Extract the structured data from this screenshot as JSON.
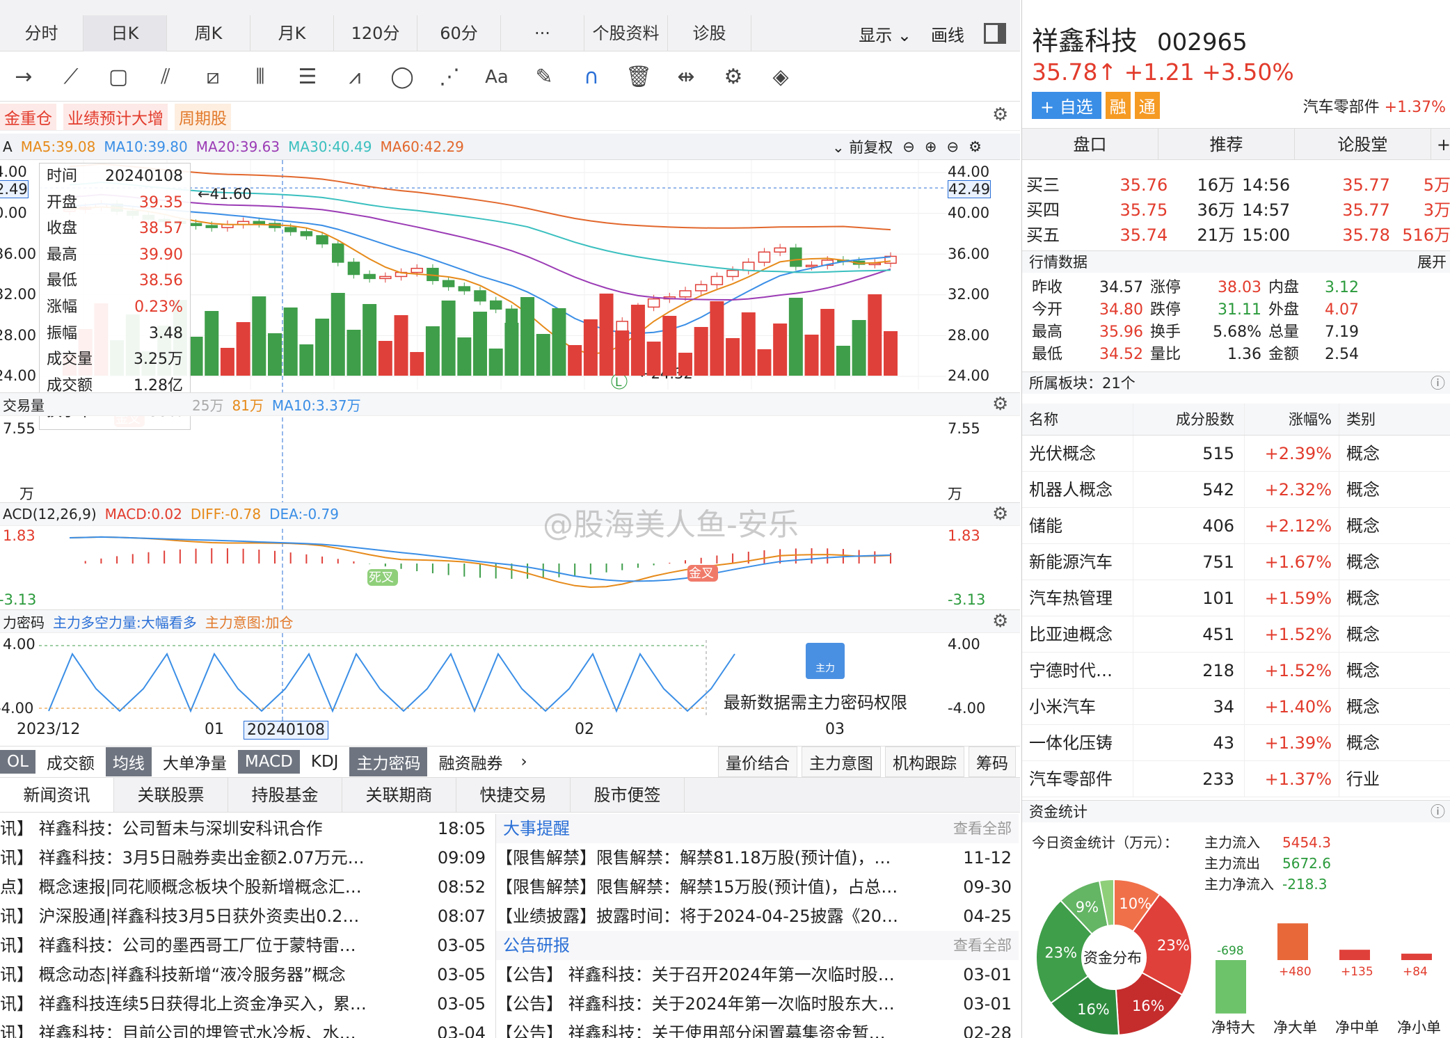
{
  "tabs": [
    "分时",
    "日K",
    "周K",
    "月K",
    "120分",
    "60分",
    "···",
    "个股资料",
    "诊股"
  ],
  "tabs_right": {
    "display": "显示",
    "draw": "画线"
  },
  "tags": [
    "金重仓",
    "业绩预计大增",
    "周期股"
  ],
  "ma": {
    "ma5": "MA5:39.08",
    "ma10": "MA10:39.80",
    "ma20": "MA20:39.63",
    "ma30": "MA30:40.49",
    "ma60": "MA60:42.29",
    "fq": "前复权",
    "ma5c": "#e68a1a",
    "ma10c": "#3a8ee6",
    "ma20c": "#9b3bb5",
    "ma30c": "#3abfbf",
    "ma60c": "#e2672c"
  },
  "y_left": [
    "4.00",
    "2.49",
    "0.00",
    "36.00",
    "32.00",
    "28.00",
    "24.00"
  ],
  "y_right": [
    "44.00",
    "42.49",
    "40.00",
    "36.00",
    "32.00",
    "28.00",
    "24.00"
  ],
  "price_labels": {
    "high": "41.60",
    "low": "←24.32",
    "low_mark": "L"
  },
  "info": [
    [
      "时间",
      "20240108"
    ],
    [
      "开盘",
      "39.35"
    ],
    [
      "收盘",
      "38.57"
    ],
    [
      "最高",
      "39.90"
    ],
    [
      "最低",
      "38.56"
    ],
    [
      "涨幅",
      "0.23%"
    ],
    [
      "振幅",
      "3.48"
    ],
    [
      "成交量",
      "3.25万"
    ],
    [
      "成交额",
      "1.28亿"
    ],
    [
      "换手率",
      "2.59%"
    ]
  ],
  "vol_head": {
    "label": "交易量",
    "v1": "25万",
    "v2": "81万",
    "ma10": "MA10:3.37万",
    "max": "7.55",
    "unit": "万"
  },
  "macd_head": {
    "label": "ACD(12,26,9)",
    "macd": "MACD:0.02",
    "diff": "DIFF:-0.78",
    "dea": "DEA:-0.79",
    "top": "1.83",
    "bottom": "-3.13",
    "gold": "金叉",
    "dead": "死叉"
  },
  "zl_head": {
    "label": "力密码",
    "l1": "主力多空力量:大幅看多",
    "l2": "主力意图:加仓",
    "top": "4.00",
    "bottom": "-4.00",
    "lock_text": "最新数据需主力密码权限",
    "lock_icon": "主力"
  },
  "xaxis": [
    "2023/12",
    "01",
    "20240108",
    "02",
    "03"
  ],
  "watermark": "@股海美人鱼-安乐",
  "indicators": [
    "OL",
    "成交额",
    "均线",
    "大单净量",
    "MACD",
    "KDJ",
    "主力密码",
    "融资融券"
  ],
  "ind_right": [
    "量价结合",
    "主力意图",
    "机构跟踪",
    "筹码"
  ],
  "news_tabs": [
    "新闻资讯",
    "关联股票",
    "持股基金",
    "关联期商",
    "快捷交易",
    "股市便签"
  ],
  "news": [
    [
      "讯】 祥鑫科技：公司暂未与深圳安科讯合作",
      "18:05"
    ],
    [
      "讯】 祥鑫科技：3月5日融券卖出金额2.07万元…",
      "09:09"
    ],
    [
      "点】 概念速报|同花顺概念板块个股新增概念汇…",
      "08:52"
    ],
    [
      "讯】 沪深股通|祥鑫科技3月5日获外资卖出0.2…",
      "08:07"
    ],
    [
      "讯】 祥鑫科技：公司的墨西哥工厂位于蒙特雷…",
      "03-05"
    ],
    [
      "讯】 概念动态|祥鑫科技新增“液冷服务器”概念",
      "03-05"
    ],
    [
      "讯】 祥鑫科技连续5日获得北上资金净买入，累…",
      "03-05"
    ],
    [
      "讯】 祥鑫科技：目前公司的埋管式水冷板、水…",
      "03-04"
    ]
  ],
  "events_head": {
    "title": "大事提醒",
    "more": "查看全部"
  },
  "events": [
    [
      "【限售解禁】限售解禁：解禁81.18万股(预计值)，…",
      "11-12"
    ],
    [
      "【限售解禁】限售解禁：解禁15万股(预计值)，占总…",
      "09-30"
    ],
    [
      "【业绩披露】披露时间：将于2024-04-25披露《20…",
      "04-25"
    ]
  ],
  "notice_head": {
    "title": "公告研报",
    "more": "查看全部"
  },
  "notices": [
    [
      "【公告】 祥鑫科技：关于召开2024年第一次临时股…",
      "03-01"
    ],
    [
      "【公告】 祥鑫科技：关于2024年第一次临时股东大…",
      "03-01"
    ],
    [
      "【公告】 祥鑫科技：关于使用部分闲置募集资金暂…",
      "02-28"
    ]
  ],
  "stock": {
    "name": "祥鑫科技",
    "code": "002965",
    "price": "35.78↑",
    "chg": "+1.21",
    "pct": "+3.50%",
    "fav": "+ 自选",
    "rong": "融",
    "tong": "通",
    "sector": "汽车零部件",
    "sector_pct": "+1.37%"
  },
  "rtabs": [
    "盘口",
    "推荐",
    "论股堂"
  ],
  "orderbook": [
    [
      "买三",
      "35.76",
      "16万",
      "14:56",
      "35.77",
      "5万"
    ],
    [
      "买四",
      "35.75",
      "36万",
      "14:57",
      "35.77",
      "3万"
    ],
    [
      "买五",
      "35.74",
      "21万",
      "15:00",
      "35.78",
      "516万"
    ]
  ],
  "qd_title": "行情数据",
  "qd_expand": "展开",
  "quote": [
    [
      "昨收",
      "34.57",
      "涨停",
      "38.03",
      "内盘",
      "3.12"
    ],
    [
      "今开",
      "34.80",
      "跌停",
      "31.11",
      "外盘",
      "4.07"
    ],
    [
      "最高",
      "35.96",
      "换手",
      "5.68%",
      "总量",
      "7.19"
    ],
    [
      "最低",
      "34.52",
      "量比",
      "1.36",
      "金额",
      "2.54"
    ]
  ],
  "sector_title": "所属板块：21个",
  "sector_head": [
    "名称",
    "成分股数",
    "涨幅%",
    "类别"
  ],
  "sectors": [
    [
      "光伏概念",
      "515",
      "+2.39%",
      "概念"
    ],
    [
      "机器人概念",
      "542",
      "+2.32%",
      "概念"
    ],
    [
      "储能",
      "406",
      "+2.12%",
      "概念"
    ],
    [
      "新能源汽车",
      "751",
      "+1.67%",
      "概念"
    ],
    [
      "汽车热管理",
      "101",
      "+1.59%",
      "概念"
    ],
    [
      "比亚迪概念",
      "451",
      "+1.52%",
      "概念"
    ],
    [
      "宁德时代…",
      "218",
      "+1.52%",
      "概念"
    ],
    [
      "小米汽车",
      "34",
      "+1.40%",
      "概念"
    ],
    [
      "一体化压铸",
      "43",
      "+1.39%",
      "概念"
    ],
    [
      "汽车零部件",
      "233",
      "+1.37%",
      "行业"
    ]
  ],
  "fund_title": "资金统计",
  "fund": {
    "label": "今日资金统计（万元）：",
    "in_l": "主力流入",
    "in": "5454.3",
    "out_l": "主力流出",
    "out": "5672.6",
    "net_l": "主力净流入",
    "net": "-218.3",
    "center": "资金分布",
    "pie": [
      [
        "10%",
        10,
        "#f0704a"
      ],
      [
        "23%",
        23,
        "#e0403a"
      ],
      [
        "16%",
        16,
        "#c52c2c"
      ],
      [
        "16%",
        16,
        "#2e8b3e"
      ],
      [
        "23%",
        23,
        "#3f9e4a"
      ],
      [
        "9%",
        9,
        "#64b564"
      ],
      [
        "3%",
        3,
        "#8fcf7a"
      ]
    ],
    "bars": [
      [
        "-698",
        "净特大",
        -698,
        "#6dc36a"
      ],
      [
        "+480",
        "净大单",
        480,
        "#e8683a"
      ],
      [
        "+135",
        "净中单",
        135,
        "#e0403a"
      ],
      [
        "+84",
        "净小单",
        84,
        "#e0403a"
      ]
    ]
  }
}
